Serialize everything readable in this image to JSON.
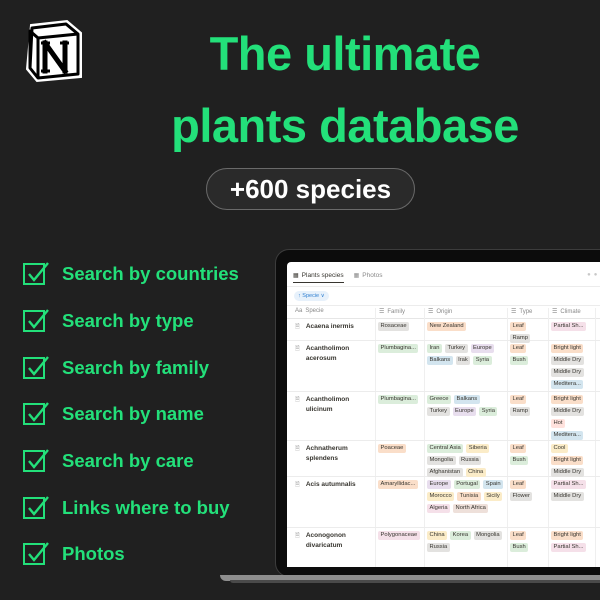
{
  "logo": {
    "icon": "notion-logo-icon"
  },
  "headline": {
    "line1": "The ultimate",
    "line2": "plants database"
  },
  "badge": {
    "label": "+600 species"
  },
  "features": [
    {
      "label": "Search by countries"
    },
    {
      "label": "Search by type"
    },
    {
      "label": "Search by family"
    },
    {
      "label": "Search by name"
    },
    {
      "label": "Search by care"
    },
    {
      "label": "Links where to buy"
    },
    {
      "label": "Photos"
    }
  ],
  "colors": {
    "accent": "#23e07a",
    "background": "#202020"
  },
  "app": {
    "tabs": [
      {
        "label": "Plants species",
        "icon": "table-icon",
        "active": true
      },
      {
        "label": "Photos",
        "icon": "gallery-icon",
        "active": false
      }
    ],
    "filter_chip": "↑ Specie ∨",
    "columns": [
      {
        "icon": "Aa",
        "label": "Specie"
      },
      {
        "icon": "☰",
        "label": "Family"
      },
      {
        "icon": "☰",
        "label": "Origin"
      },
      {
        "icon": "☰",
        "label": "Type"
      },
      {
        "icon": "☰",
        "label": "Climate"
      },
      {
        "icon": "",
        "label": ""
      }
    ],
    "rows": [
      {
        "name": "Acaena inermis",
        "family": [
          {
            "t": "Rosaceae",
            "c": "gray"
          }
        ],
        "origin": [
          {
            "t": "New Zealand",
            "c": "orange"
          }
        ],
        "type": [
          {
            "t": "Leaf",
            "c": "orange"
          },
          {
            "t": "Ramp",
            "c": "gray"
          }
        ],
        "climate": [
          {
            "t": "Partial Sh...",
            "c": "pink"
          }
        ]
      },
      {
        "name": "Acantholimon acerosum",
        "family": [
          {
            "t": "Plumbagina...",
            "c": "green"
          }
        ],
        "origin": [
          {
            "t": "Iran",
            "c": "green"
          },
          {
            "t": "Turkey",
            "c": "gray"
          },
          {
            "t": "Europe",
            "c": "purple"
          },
          {
            "t": "Balkans",
            "c": "blue"
          },
          {
            "t": "Irak",
            "c": "gray"
          },
          {
            "t": "Syria",
            "c": "green"
          }
        ],
        "type": [
          {
            "t": "Leaf",
            "c": "orange"
          },
          {
            "t": "Bush",
            "c": "green"
          }
        ],
        "climate": [
          {
            "t": "Bright light",
            "c": "orange"
          },
          {
            "t": "Middle Dry",
            "c": "gray"
          },
          {
            "t": "Middle Dry",
            "c": "gray"
          },
          {
            "t": "Meditera...",
            "c": "blue"
          }
        ]
      },
      {
        "name": "Acantholimon ulicinum",
        "family": [
          {
            "t": "Plumbagina...",
            "c": "green"
          }
        ],
        "origin": [
          {
            "t": "Greece",
            "c": "green"
          },
          {
            "t": "Balkans",
            "c": "blue"
          },
          {
            "t": "Turkey",
            "c": "gray"
          },
          {
            "t": "Europe",
            "c": "purple"
          },
          {
            "t": "Syria",
            "c": "green"
          }
        ],
        "type": [
          {
            "t": "Leaf",
            "c": "orange"
          },
          {
            "t": "Ramp",
            "c": "gray"
          }
        ],
        "climate": [
          {
            "t": "Bright light",
            "c": "orange"
          },
          {
            "t": "Middle Dry",
            "c": "gray"
          },
          {
            "t": "Hot",
            "c": "red"
          },
          {
            "t": "Meditera...",
            "c": "blue"
          }
        ]
      },
      {
        "name": "Achnatherum splendens",
        "family": [
          {
            "t": "Poaceae",
            "c": "orange"
          }
        ],
        "origin": [
          {
            "t": "Central Asia",
            "c": "green"
          },
          {
            "t": "Siberia",
            "c": "yellow"
          },
          {
            "t": "Mongolia",
            "c": "gray"
          },
          {
            "t": "Russia",
            "c": "gray"
          },
          {
            "t": "Afghanistan",
            "c": "gray"
          },
          {
            "t": "China",
            "c": "yellow"
          }
        ],
        "type": [
          {
            "t": "Leaf",
            "c": "orange"
          },
          {
            "t": "Bush",
            "c": "green"
          }
        ],
        "climate": [
          {
            "t": "Cool",
            "c": "yellow"
          },
          {
            "t": "Bright light",
            "c": "orange"
          },
          {
            "t": "Middle Dry",
            "c": "gray"
          }
        ]
      },
      {
        "name": "Acis autumnalis",
        "family": [
          {
            "t": "Amaryllidac...",
            "c": "orange"
          }
        ],
        "origin": [
          {
            "t": "Europe",
            "c": "purple"
          },
          {
            "t": "Portugal",
            "c": "green"
          },
          {
            "t": "Spain",
            "c": "blue"
          },
          {
            "t": "Morocco",
            "c": "yellow"
          },
          {
            "t": "Tunisia",
            "c": "orange"
          },
          {
            "t": "Sicily",
            "c": "yellow"
          },
          {
            "t": "Algeria",
            "c": "pink"
          },
          {
            "t": "North Africa",
            "c": "brown"
          }
        ],
        "type": [
          {
            "t": "Leaf",
            "c": "orange"
          },
          {
            "t": "Flower",
            "c": "gray"
          }
        ],
        "climate": [
          {
            "t": "Partial Sh...",
            "c": "pink"
          },
          {
            "t": "Middle Dry",
            "c": "gray"
          }
        ]
      },
      {
        "name": "Aconogonon divaricatum",
        "family": [
          {
            "t": "Polygonaceae",
            "c": "pink"
          }
        ],
        "origin": [
          {
            "t": "China",
            "c": "yellow"
          },
          {
            "t": "Korea",
            "c": "green"
          },
          {
            "t": "Mongolia",
            "c": "gray"
          },
          {
            "t": "Russia",
            "c": "gray"
          }
        ],
        "type": [
          {
            "t": "Leaf",
            "c": "orange"
          },
          {
            "t": "Bush",
            "c": "green"
          }
        ],
        "climate": [
          {
            "t": "Bright light",
            "c": "orange"
          },
          {
            "t": "Partial Sh...",
            "c": "pink"
          }
        ]
      }
    ]
  }
}
